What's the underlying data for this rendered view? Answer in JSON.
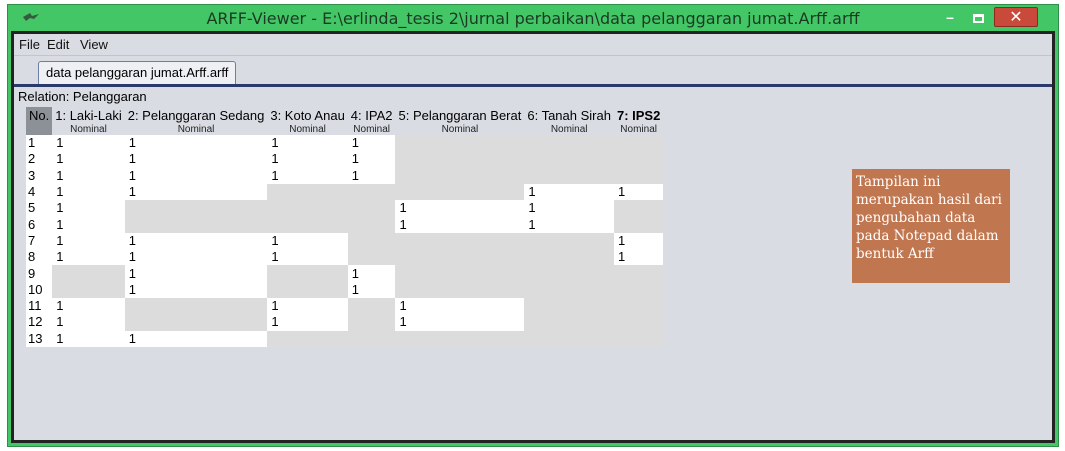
{
  "window": {
    "title": "ARFF-Viewer - E:\\erlinda_tesis 2\\jurnal perbaikan\\data pelanggaran jumat.Arff.arff",
    "minimize": "–",
    "close": "✕"
  },
  "menu": [
    "File",
    "Edit",
    "View"
  ],
  "tab": {
    "label": "data pelanggaran jumat.Arff.arff"
  },
  "relation": "Relation: Pelanggaran",
  "table": {
    "no_header": "No.",
    "columns": [
      {
        "name": "1: Laki-Laki",
        "type": "Nominal"
      },
      {
        "name": "2: Pelanggaran Sedang",
        "type": "Nominal"
      },
      {
        "name": "3: Koto Anau",
        "type": "Nominal"
      },
      {
        "name": "4: IPA2",
        "type": "Nominal"
      },
      {
        "name": "5: Pelanggaran Berat",
        "type": "Nominal"
      },
      {
        "name": "6: Tanah Sirah",
        "type": "Nominal"
      },
      {
        "name": "7: IPS2",
        "type": "Nominal"
      }
    ],
    "rows": [
      {
        "no": "1",
        "cells": [
          "1",
          "1",
          "1",
          "1",
          "",
          "",
          ""
        ]
      },
      {
        "no": "2",
        "cells": [
          "1",
          "1",
          "1",
          "1",
          "",
          "",
          ""
        ]
      },
      {
        "no": "3",
        "cells": [
          "1",
          "1",
          "1",
          "1",
          "",
          "",
          ""
        ]
      },
      {
        "no": "4",
        "cells": [
          "1",
          "1",
          "",
          "",
          "",
          "1",
          "1"
        ]
      },
      {
        "no": "5",
        "cells": [
          "1",
          "",
          "",
          "",
          "1",
          "1",
          ""
        ]
      },
      {
        "no": "6",
        "cells": [
          "1",
          "",
          "",
          "",
          "1",
          "1",
          ""
        ]
      },
      {
        "no": "7",
        "cells": [
          "1",
          "1",
          "1",
          "",
          "",
          "",
          "1"
        ]
      },
      {
        "no": "8",
        "cells": [
          "1",
          "1",
          "1",
          "",
          "",
          "",
          "1"
        ]
      },
      {
        "no": "9",
        "cells": [
          "",
          "1",
          "",
          "1",
          "",
          "",
          ""
        ]
      },
      {
        "no": "10",
        "cells": [
          "",
          "1",
          "",
          "1",
          "",
          "",
          ""
        ]
      },
      {
        "no": "11",
        "cells": [
          "1",
          "",
          "1",
          "",
          "1",
          "",
          ""
        ]
      },
      {
        "no": "12",
        "cells": [
          "1",
          "",
          "1",
          "",
          "1",
          "",
          ""
        ]
      },
      {
        "no": "13",
        "cells": [
          "1",
          "1",
          "",
          "",
          "",
          "",
          ""
        ]
      }
    ]
  },
  "note": "Tampilan ini merupakan hasil dari pengubahan data pada Notepad dalam bentuk Arff",
  "colors": {
    "titlebar": "#43c766",
    "note_bg": "#c0764f",
    "close_button": "#c94a3a"
  }
}
